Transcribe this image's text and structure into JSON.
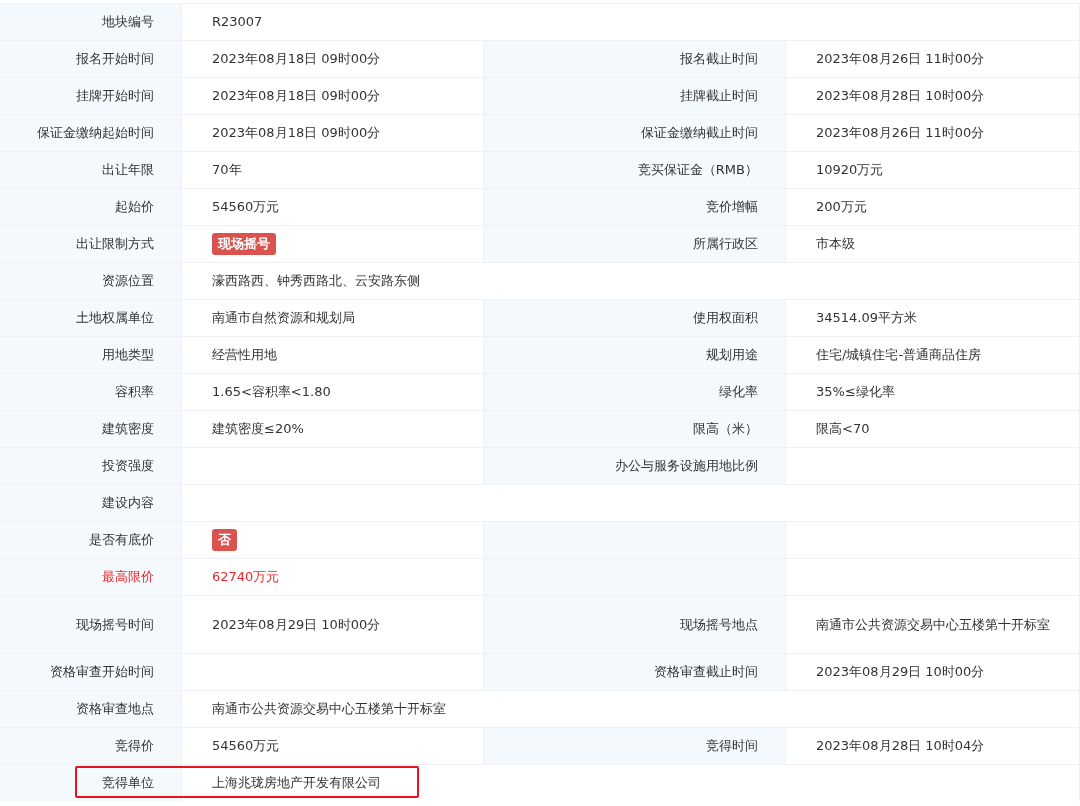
{
  "rows": [
    {
      "pairs": [
        {
          "label": "地块编号",
          "value": "R23007"
        }
      ]
    },
    {
      "pairs": [
        {
          "label": "报名开始时间",
          "value": "2023年08月18日 09时00分"
        },
        {
          "label": "报名截止时间",
          "value": "2023年08月26日 11时00分"
        }
      ]
    },
    {
      "pairs": [
        {
          "label": "挂牌开始时间",
          "value": "2023年08月18日 09时00分"
        },
        {
          "label": "挂牌截止时间",
          "value": "2023年08月28日 10时00分"
        }
      ]
    },
    {
      "pairs": [
        {
          "label": "保证金缴纳起始时间",
          "value": "2023年08月18日 09时00分"
        },
        {
          "label": "保证金缴纳截止时间",
          "value": "2023年08月26日 11时00分"
        }
      ]
    },
    {
      "pairs": [
        {
          "label": "出让年限",
          "value": "70年"
        },
        {
          "label": "竞买保证金（RMB）",
          "value": "10920万元"
        }
      ]
    },
    {
      "pairs": [
        {
          "label": "起始价",
          "value": "54560万元"
        },
        {
          "label": "竞价增幅",
          "value": "200万元"
        }
      ]
    },
    {
      "pairs": [
        {
          "label": "出让限制方式",
          "value": "现场摇号",
          "kind": "tag"
        },
        {
          "label": "所属行政区",
          "value": "市本级"
        }
      ]
    },
    {
      "pairs": [
        {
          "label": "资源位置",
          "value": "濠西路西、钟秀西路北、云安路东侧"
        }
      ]
    },
    {
      "pairs": [
        {
          "label": "土地权属单位",
          "value": "南通市自然资源和规划局"
        },
        {
          "label": "使用权面积",
          "value": "34514.09平方米"
        }
      ]
    },
    {
      "pairs": [
        {
          "label": "用地类型",
          "value": "经营性用地"
        },
        {
          "label": "规划用途",
          "value": "住宅/城镇住宅-普通商品住房"
        }
      ]
    },
    {
      "pairs": [
        {
          "label": "容积率",
          "value": "1.65<容积率<1.80"
        },
        {
          "label": "绿化率",
          "value": "35%≤绿化率"
        }
      ]
    },
    {
      "pairs": [
        {
          "label": "建筑密度",
          "value": "建筑密度≤20%"
        },
        {
          "label": "限高（米）",
          "value": "限高<70"
        }
      ]
    },
    {
      "pairs": [
        {
          "label": "投资强度"
        },
        {
          "label": "办公与服务设施用地比例"
        }
      ]
    },
    {
      "pairs": [
        {
          "label": "建设内容"
        }
      ]
    },
    {
      "split": true,
      "pairs": [
        {
          "label": "是否有底价",
          "value": "否",
          "kind": "tag"
        }
      ]
    },
    {
      "split": true,
      "pairs": [
        {
          "label": "最高限价",
          "value": "62740万元",
          "emphasis": true
        }
      ]
    },
    {
      "pairs": [
        {
          "label": "现场摇号时间",
          "value": "2023年08月29日 10时00分"
        },
        {
          "label": "现场摇号地点",
          "value": "南通市公共资源交易中心五楼第十开标室"
        }
      ]
    },
    {
      "pairs": [
        {
          "label": "资格审查开始时间"
        },
        {
          "label": "资格审查截止时间",
          "value": "2023年08月29日 10时00分"
        }
      ]
    },
    {
      "pairs": [
        {
          "label": "资格审查地点",
          "value": "南通市公共资源交易中心五楼第十开标室"
        }
      ]
    },
    {
      "pairs": [
        {
          "label": "竞得价",
          "value": "54560万元"
        },
        {
          "label": "竞得时间",
          "value": "2023年08月28日 10时04分"
        }
      ]
    },
    {
      "highlighted": true,
      "pairs": [
        {
          "label": "竞得单位",
          "value": "上海兆珑房地产开发有限公司"
        }
      ]
    }
  ]
}
